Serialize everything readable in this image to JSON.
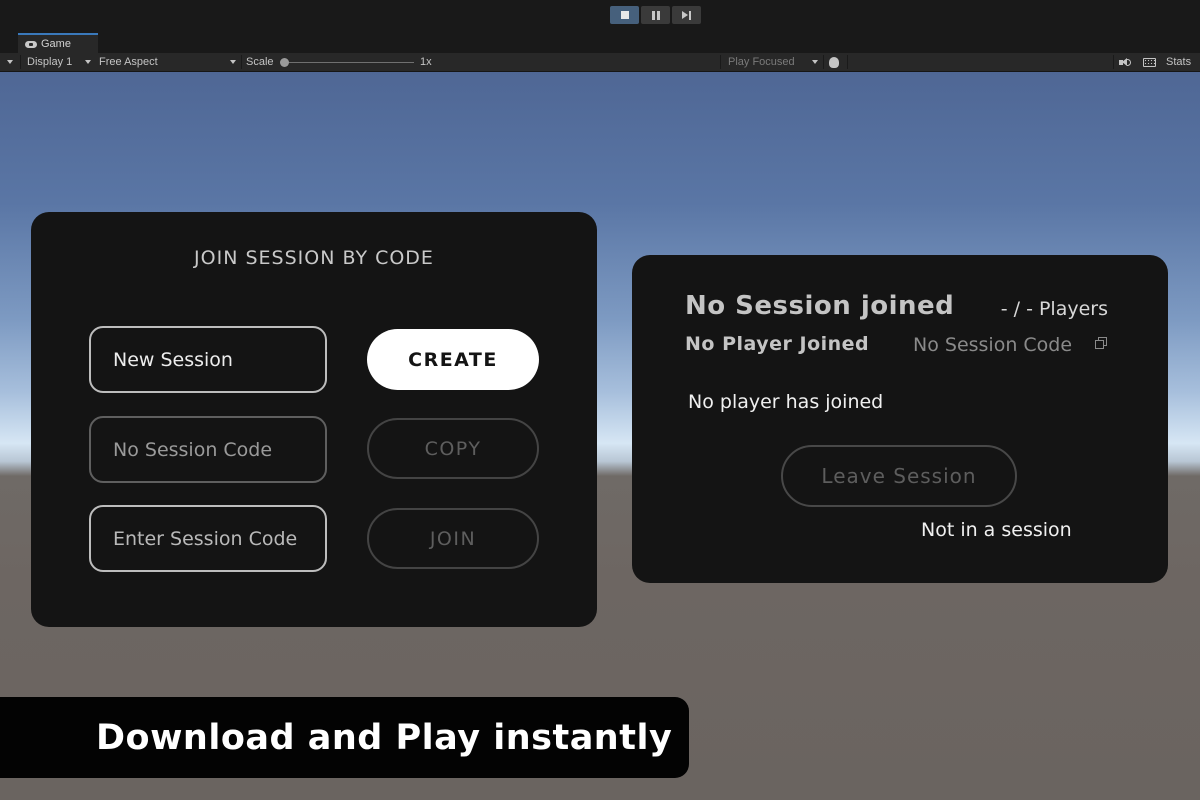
{
  "editor": {
    "play_controls": {
      "play_icon": "stop-square-icon",
      "pause_icon": "pause-icon",
      "step_icon": "step-forward-icon",
      "active_color": "#46607c"
    },
    "tab": {
      "label": "Game",
      "icon": "gamepad-icon"
    },
    "toolbar": {
      "display": "Display 1",
      "aspect": "Free Aspect",
      "scale_label": "Scale",
      "scale_value": "1x",
      "play_focused": "Play Focused",
      "stats": "Stats"
    }
  },
  "join_panel": {
    "title": "JOIN SESSION BY CODE",
    "session_name_value": "New Session",
    "session_code_placeholder": "No Session Code",
    "enter_code_placeholder": "Enter Session Code",
    "create_label": "CREATE",
    "copy_label": "COPY",
    "join_label": "JOIN"
  },
  "session_panel": {
    "title": "No Session joined",
    "players": "- / - Players",
    "player_joined": "No Player Joined",
    "session_code": "No Session Code",
    "player_list_empty": "No player has joined",
    "leave_label": "Leave Session",
    "status": "Not in a session"
  },
  "banner": {
    "text": "Download and Play instantly"
  }
}
